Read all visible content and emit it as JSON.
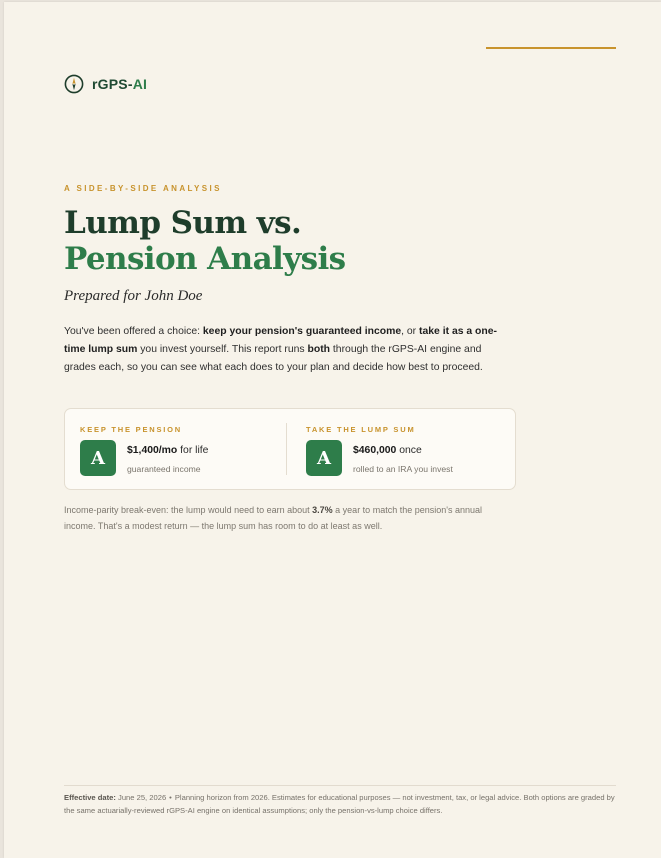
{
  "brand": {
    "name_main": "rGPS-",
    "name_accent": "AI",
    "icon": "compass-icon"
  },
  "colors": {
    "accent_gold": "#c8932d",
    "brand_green": "#2e7d4a",
    "dark_green": "#1e3d2b",
    "page_bg": "#f7f3ea"
  },
  "header": {
    "eyebrow": "A SIDE-BY-SIDE ANALYSIS",
    "title_line1": "Lump Sum vs.",
    "title_line2": "Pension Analysis",
    "prepared_for": "Prepared for John Doe"
  },
  "intro": {
    "p1": "You've been offered a choice: ",
    "b1": "keep your pension's guaranteed income",
    "p2": ", or ",
    "b2": "take it as a one-time lump sum",
    "p3": " you invest yourself. This report runs ",
    "b3": "both",
    "p4": " through the rGPS-AI engine and grades each, so you can see what each does to your plan and decide how best to proceed."
  },
  "options": [
    {
      "label": "KEEP THE PENSION",
      "grade": "A",
      "amount": "$1,400/mo",
      "suffix": " for life",
      "detail": "guaranteed income"
    },
    {
      "label": "TAKE THE LUMP SUM",
      "grade": "A",
      "amount": "$460,000",
      "suffix": " once",
      "detail": "rolled to an IRA you invest"
    }
  ],
  "breakeven": {
    "p1": "Income-parity break-even: the lump would need to earn about ",
    "rate": "3.7%",
    "p2": " a year to match the pension's annual income. That's a modest return — the lump sum has room to do at least as well."
  },
  "footer": {
    "label": "Effective date:",
    "date": " June 25, 2026",
    "dot": "•",
    "text": "Planning horizon from 2026. Estimates for educational purposes — not investment, tax, or legal advice. Both options are graded by the same actuarially-reviewed rGPS-AI engine on identical assumptions; only the pension-vs-lump choice differs."
  }
}
